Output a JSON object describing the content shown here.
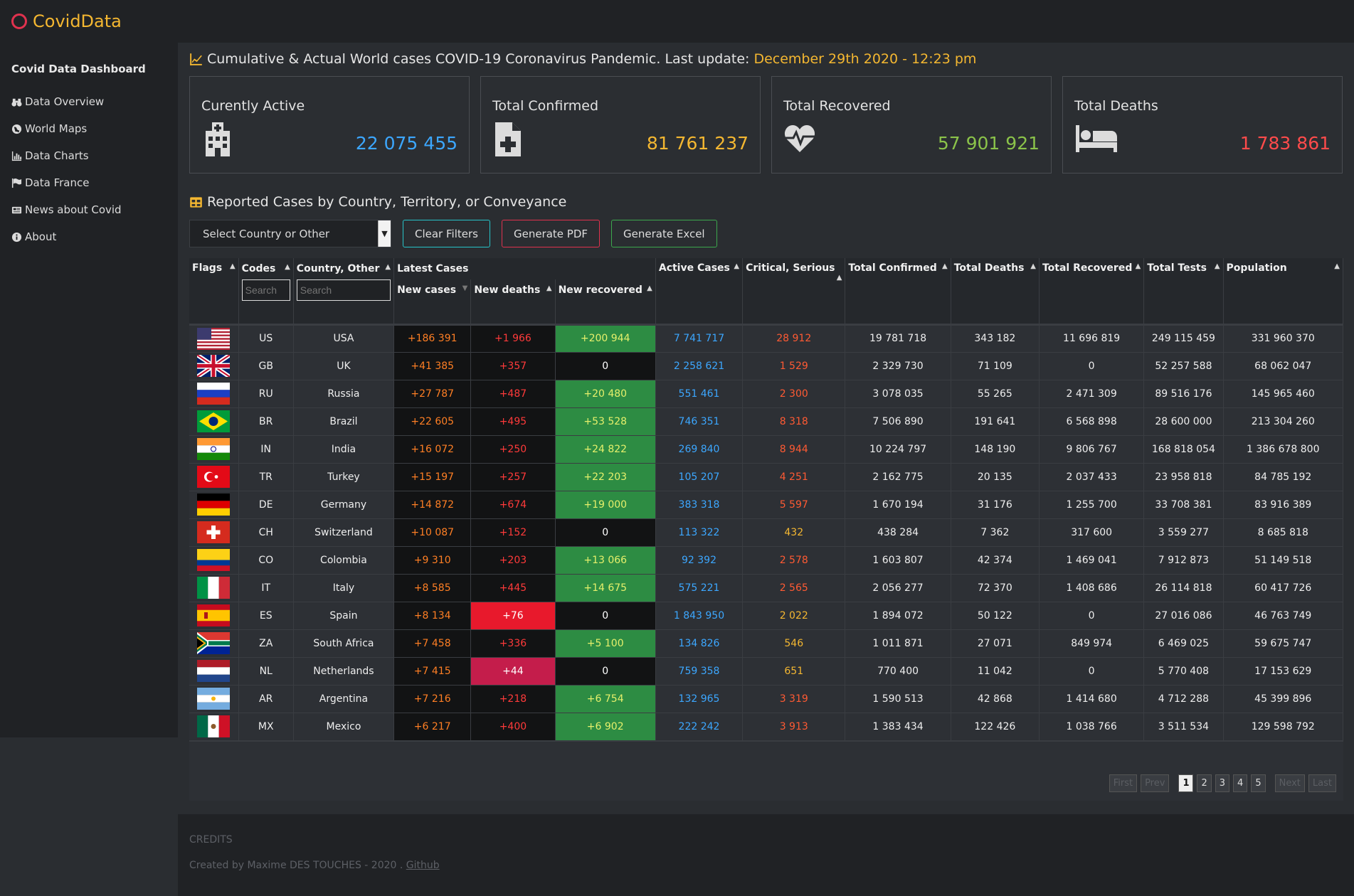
{
  "brand": "CovidData",
  "sidebar": {
    "title": "Covid Data Dashboard",
    "items": [
      {
        "label": "Data Overview",
        "icon": "binoculars-icon"
      },
      {
        "label": "World Maps",
        "icon": "globe-icon"
      },
      {
        "label": "Data Charts",
        "icon": "bar-chart-icon"
      },
      {
        "label": "Data France",
        "icon": "flag-icon"
      },
      {
        "label": "News about Covid",
        "icon": "newspaper-icon"
      },
      {
        "label": "About",
        "icon": "info-icon"
      }
    ]
  },
  "header": {
    "title": "Cumulative & Actual World cases COVID-19 Coronavirus Pandemic. Last update:",
    "date": "December 29th 2020 - 12:23 pm"
  },
  "cards": [
    {
      "label": "Curently Active",
      "value": "22 075 455",
      "color": "#3ca7ff",
      "icon": "hospital-icon"
    },
    {
      "label": "Total Confirmed",
      "value": "81 761 237",
      "color": "#f4b731",
      "icon": "medical-file-icon"
    },
    {
      "label": "Total Recovered",
      "value": "57 901 921",
      "color": "#8bc34a",
      "icon": "heartbeat-icon"
    },
    {
      "label": "Total Deaths",
      "value": "1 783 861",
      "color": "#ff4b4b",
      "icon": "bed-icon"
    }
  ],
  "reported": {
    "title": "Reported Cases by Country, Territory, or Conveyance"
  },
  "filters": {
    "select_placeholder": "Select Country or Other",
    "clear": "Clear Filters",
    "pdf": "Generate PDF",
    "excel": "Generate Excel"
  },
  "table": {
    "headers": {
      "flags": "Flags",
      "codes": "Codes",
      "country": "Country, Other",
      "latest": "Latest Cases",
      "new_cases": "New cases",
      "new_deaths": "New deaths",
      "new_recovered": "New recovered",
      "active": "Active Cases",
      "critical": "Critical, Serious",
      "total_confirmed": "Total Confirmed",
      "total_deaths": "Total Deaths",
      "total_recovered": "Total Recovered",
      "total_tests": "Total Tests",
      "population": "Population"
    },
    "search_placeholder": "Search",
    "rows": [
      {
        "code": "US",
        "country": "USA",
        "new_cases": "+186 391",
        "new_deaths": "+1 966",
        "new_recovered": "+200 944",
        "active": "7 741 717",
        "critical": "28 912",
        "confirmed": "19 781 718",
        "deaths": "343 182",
        "recovered": "11 696 819",
        "tests": "249 115 459",
        "population": "331 960 370"
      },
      {
        "code": "GB",
        "country": "UK",
        "new_cases": "+41 385",
        "new_deaths": "+357",
        "new_recovered": "0",
        "active": "2 258 621",
        "critical": "1 529",
        "confirmed": "2 329 730",
        "deaths": "71 109",
        "recovered": "0",
        "tests": "52 257 588",
        "population": "68 062 047"
      },
      {
        "code": "RU",
        "country": "Russia",
        "new_cases": "+27 787",
        "new_deaths": "+487",
        "new_recovered": "+20 480",
        "active": "551 461",
        "critical": "2 300",
        "confirmed": "3 078 035",
        "deaths": "55 265",
        "recovered": "2 471 309",
        "tests": "89 516 176",
        "population": "145 965 460"
      },
      {
        "code": "BR",
        "country": "Brazil",
        "new_cases": "+22 605",
        "new_deaths": "+495",
        "new_recovered": "+53 528",
        "active": "746 351",
        "critical": "8 318",
        "confirmed": "7 506 890",
        "deaths": "191 641",
        "recovered": "6 568 898",
        "tests": "28 600 000",
        "population": "213 304 260"
      },
      {
        "code": "IN",
        "country": "India",
        "new_cases": "+16 072",
        "new_deaths": "+250",
        "new_recovered": "+24 822",
        "active": "269 840",
        "critical": "8 944",
        "confirmed": "10 224 797",
        "deaths": "148 190",
        "recovered": "9 806 767",
        "tests": "168 818 054",
        "population": "1 386 678 800"
      },
      {
        "code": "TR",
        "country": "Turkey",
        "new_cases": "+15 197",
        "new_deaths": "+257",
        "new_recovered": "+22 203",
        "active": "105 207",
        "critical": "4 251",
        "confirmed": "2 162 775",
        "deaths": "20 135",
        "recovered": "2 037 433",
        "tests": "23 958 818",
        "population": "84 785 192"
      },
      {
        "code": "DE",
        "country": "Germany",
        "new_cases": "+14 872",
        "new_deaths": "+674",
        "new_recovered": "+19 000",
        "active": "383 318",
        "critical": "5 597",
        "confirmed": "1 670 194",
        "deaths": "31 176",
        "recovered": "1 255 700",
        "tests": "33 708 381",
        "population": "83 916 389"
      },
      {
        "code": "CH",
        "country": "Switzerland",
        "new_cases": "+10 087",
        "new_deaths": "+152",
        "new_recovered": "0",
        "active": "113 322",
        "critical": "432",
        "confirmed": "438 284",
        "deaths": "7 362",
        "recovered": "317 600",
        "tests": "3 559 277",
        "population": "8 685 818"
      },
      {
        "code": "CO",
        "country": "Colombia",
        "new_cases": "+9 310",
        "new_deaths": "+203",
        "new_recovered": "+13 066",
        "active": "92 392",
        "critical": "2 578",
        "confirmed": "1 603 807",
        "deaths": "42 374",
        "recovered": "1 469 041",
        "tests": "7 912 873",
        "population": "51 149 518"
      },
      {
        "code": "IT",
        "country": "Italy",
        "new_cases": "+8 585",
        "new_deaths": "+445",
        "new_recovered": "+14 675",
        "active": "575 221",
        "critical": "2 565",
        "confirmed": "2 056 277",
        "deaths": "72 370",
        "recovered": "1 408 686",
        "tests": "26 114 818",
        "population": "60 417 726"
      },
      {
        "code": "ES",
        "country": "Spain",
        "new_cases": "+8 134",
        "new_deaths": "+76",
        "new_recovered": "0",
        "active": "1 843 950",
        "critical": "2 022",
        "confirmed": "1 894 072",
        "deaths": "50 122",
        "recovered": "0",
        "tests": "27 016 086",
        "population": "46 763 749"
      },
      {
        "code": "ZA",
        "country": "South Africa",
        "new_cases": "+7 458",
        "new_deaths": "+336",
        "new_recovered": "+5 100",
        "active": "134 826",
        "critical": "546",
        "confirmed": "1 011 871",
        "deaths": "27 071",
        "recovered": "849 974",
        "tests": "6 469 025",
        "population": "59 675 747"
      },
      {
        "code": "NL",
        "country": "Netherlands",
        "new_cases": "+7 415",
        "new_deaths": "+44",
        "new_recovered": "0",
        "active": "759 358",
        "critical": "651",
        "confirmed": "770 400",
        "deaths": "11 042",
        "recovered": "0",
        "tests": "5 770 408",
        "population": "17 153 629"
      },
      {
        "code": "AR",
        "country": "Argentina",
        "new_cases": "+7 216",
        "new_deaths": "+218",
        "new_recovered": "+6 754",
        "active": "132 965",
        "critical": "3 319",
        "confirmed": "1 590 513",
        "deaths": "42 868",
        "recovered": "1 414 680",
        "tests": "4 712 288",
        "population": "45 399 896"
      },
      {
        "code": "MX",
        "country": "Mexico",
        "new_cases": "+6 217",
        "new_deaths": "+400",
        "new_recovered": "+6 902",
        "active": "222 242",
        "critical": "3 913",
        "confirmed": "1 383 434",
        "deaths": "122 426",
        "recovered": "1 038 766",
        "tests": "3 511 534",
        "population": "129 598 792"
      }
    ]
  },
  "pagination": {
    "first": "First",
    "prev": "Prev",
    "pages": [
      "1",
      "2",
      "3",
      "4",
      "5"
    ],
    "next": "Next",
    "last": "Last"
  },
  "footer": {
    "credits": "CREDITS",
    "created": "Created by Maxime DES TOUCHES - 2020 .",
    "link": "Github"
  }
}
